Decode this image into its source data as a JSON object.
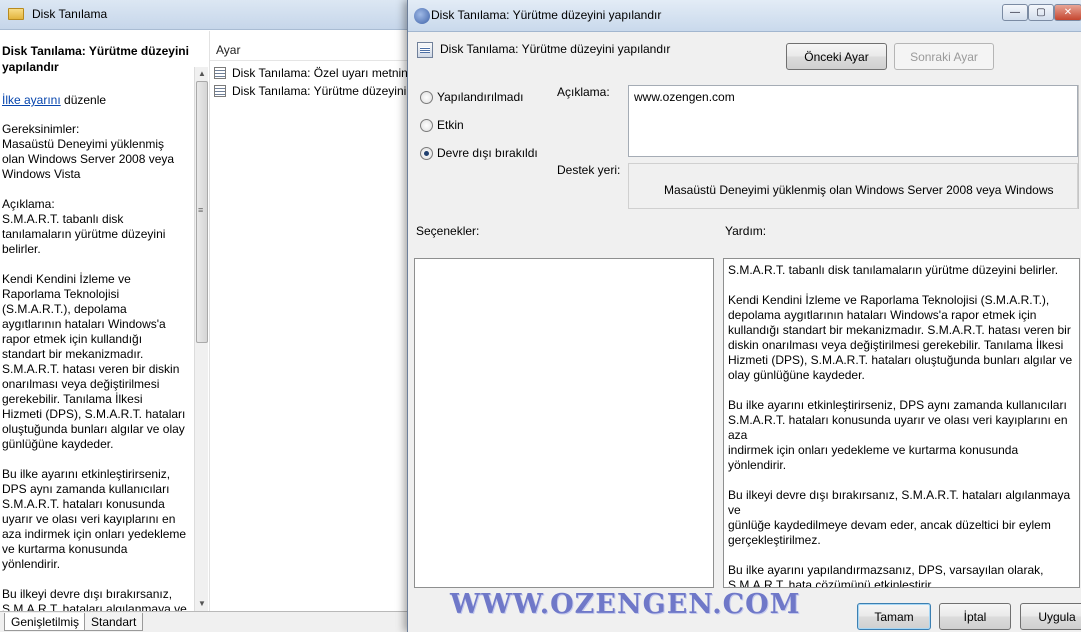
{
  "background_window": {
    "title": "Disk Tanılama",
    "left_pane": {
      "heading": "Disk Tanılama: Yürütme düzeyini yapılandır",
      "edit_link": "İlke ayarını",
      "edit_suffix": " düzenle",
      "requirements": "Gereksinimler:\nMasaüstü Deneyimi yüklenmiş\nolan Windows Server 2008 veya\nWindows Vista",
      "description": "Açıklama:\nS.M.A.R.T. tabanlı disk\ntanılamaların yürütme düzeyini\nbelirler.",
      "para_smart": "Kendi Kendini İzleme ve\nRaporlama Teknolojisi\n(S.M.A.R.T.), depolama\naygıtlarının hataları Windows'a\nrapor etmek için kullandığı\nstandart bir mekanizmadır.\nS.M.A.R.T. hatası veren bir diskin\nonarılması veya değiştirilmesi\ngerekebilir. Tanılama İlkesi\nHizmeti (DPS), S.M.A.R.T. hataları\noluştuğunda bunları algılar ve olay\ngünlüğüne kaydeder.",
      "para_enable": "Bu ilke ayarını etkinleştirirseniz,\nDPS aynı zamanda kullanıcıları\nS.M.A.R.T. hataları konusunda\nuyarır ve olası veri kayıplarını en\naza indirmek için onları yedekleme\nve kurtarma konusunda\nyönlendirir.",
      "para_disable": "Bu ilkeyi devre dışı bırakırsanız,\nS.M.A.R.T. hataları algılanmaya ve"
    },
    "list": {
      "column_header": "Ayar",
      "rows": [
        "Disk Tanılama: Özel uyarı metnini",
        "Disk Tanılama: Yürütme düzeyini"
      ]
    },
    "tabs": [
      "Genişletilmiş",
      "Standart"
    ]
  },
  "dialog": {
    "title": "Disk Tanılama: Yürütme düzeyini yapılandır",
    "header": "Disk Tanılama: Yürütme düzeyini yapılandır",
    "prev_button": "Önceki Ayar",
    "next_button": "Sonraki Ayar",
    "radios": [
      {
        "label": "Yapılandırılmadı",
        "checked": false
      },
      {
        "label": "Etkin",
        "checked": false
      },
      {
        "label": "Devre dışı bırakıldı",
        "checked": true
      }
    ],
    "comment_label": "Açıklama:",
    "comment_value": "www.ozengen.com",
    "supported_label": "Destek yeri:",
    "supported_value": "Masaüstü Deneyimi yüklenmiş olan Windows Server 2008 veya Windows",
    "options_label": "Seçenekler:",
    "help_label": "Yardım:",
    "help_paragraphs": [
      "S.M.A.R.T. tabanlı disk tanılamaların yürütme düzeyini belirler.",
      "Kendi Kendini İzleme ve Raporlama Teknolojisi (S.M.A.R.T.),\ndepolama aygıtlarının hataları Windows'a rapor etmek için\nkullandığı standart bir mekanizmadır. S.M.A.R.T. hatası veren bir\ndiskin onarılması veya değiştirilmesi gerekebilir. Tanılama İlkesi\nHizmeti (DPS), S.M.A.R.T. hataları oluştuğunda bunları algılar ve\nolay günlüğüne kaydeder.",
      "Bu ilke ayarını etkinleştirirseniz, DPS aynı zamanda kullanıcıları\nS.M.A.R.T. hataları konusunda uyarır ve olası veri kayıplarını en aza\nindirmek için onları yedekleme ve kurtarma konusunda\nyönlendirir.",
      "Bu ilkeyi devre dışı bırakırsanız, S.M.A.R.T. hataları algılanmaya ve\ngünlüğe kaydedilmeye devam eder, ancak düzeltici bir eylem\ngerçekleştirilmez.",
      "Bu ilke ayarını yapılandırmazsanız, DPS, varsayılan olarak,\nS.M.A.R.T. hata çözümünü etkinleştirir."
    ],
    "ok_button": "Tamam",
    "cancel_button": "İptal",
    "apply_button": "Uygula",
    "watermark": "WWW.OZENGEN.COM"
  }
}
